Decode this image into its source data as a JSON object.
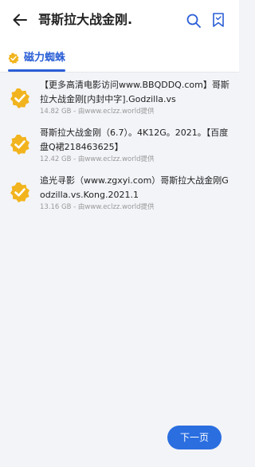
{
  "header": {
    "title": "哥斯拉大战金刚."
  },
  "icons": {
    "back": "back-arrow-icon",
    "search": "search-icon",
    "bookmark": "bookmark-icon",
    "tab": "verified-badge-icon",
    "result": "verified-check-icon"
  },
  "colors": {
    "accent": "#2a5ed6",
    "badge": "#f2b41e",
    "button": "#2a6ee0"
  },
  "tabs": [
    {
      "label": "磁力蜘蛛",
      "active": true
    }
  ],
  "results": [
    {
      "name": "【更多高清电影访问www.BBQDDQ.com】哥斯拉大战金刚[内封中字].Godzilla.vs",
      "meta": "14.82 GB - 由www.eclzz.world提供"
    },
    {
      "name": "哥斯拉大战金刚（6.7）。4K12G。2021。【百度盘Q裙218463625】",
      "meta": "12.42 GB - 由www.eclzz.world提供"
    },
    {
      "name": "追光寻影（www.zgxyi.com）哥斯拉大战金刚Godzilla.vs.Kong.2021.1",
      "meta": "13.16 GB - 由www.eclzz.world提供"
    }
  ],
  "footer": {
    "next_label": "下一页"
  }
}
